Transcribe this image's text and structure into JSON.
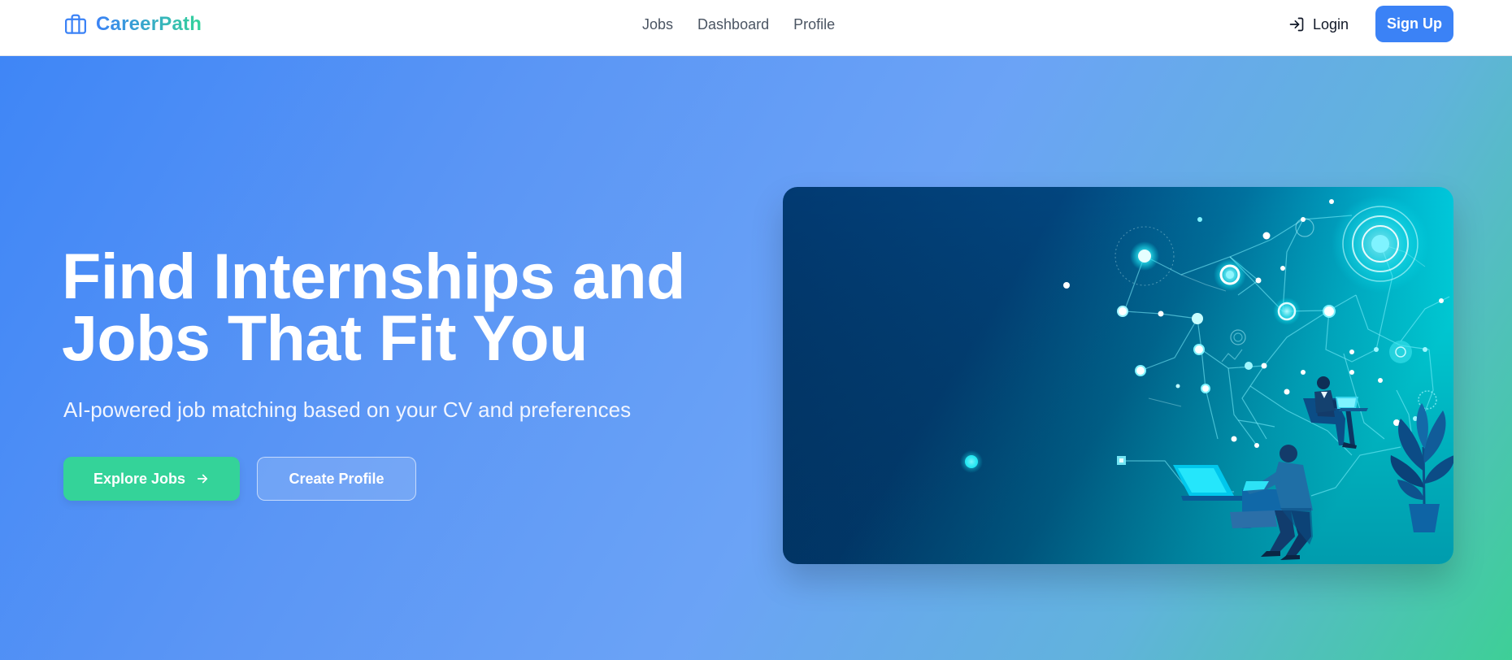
{
  "nav": {
    "brand": "CareerPath",
    "brand_icon": "briefcase-icon",
    "links": [
      "Jobs",
      "Dashboard",
      "Profile"
    ],
    "login_label": "Login",
    "login_icon": "login-icon",
    "signup_label": "Sign Up"
  },
  "hero": {
    "headline_line1": "Find Internships and",
    "headline_line2": "Jobs That Fit You",
    "subheadline": "AI-powered job matching based on your CV and preferences",
    "primary_button": "Explore Jobs",
    "primary_button_icon": "arrow-right-icon",
    "secondary_button": "Create Profile",
    "illustration": "network-people-laptops-illustration"
  },
  "colors": {
    "primary": "#3b82f6",
    "accent": "#34d399",
    "nav_text": "#4b5563",
    "hero_start": "#3f86f6",
    "hero_end": "#3ecf97",
    "illustration_dark": "#033a74",
    "illustration_cyan": "#00e5f0"
  }
}
